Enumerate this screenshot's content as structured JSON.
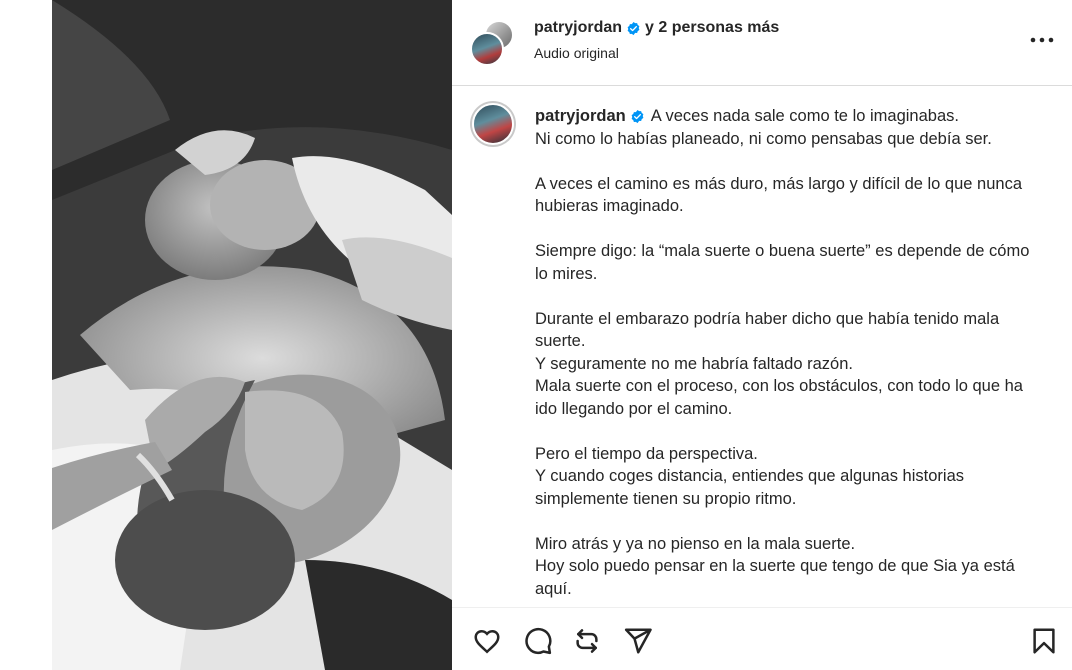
{
  "post": {
    "header": {
      "username": "patryjordan",
      "collab_text": "y 2 personas más",
      "audio": "Audio original",
      "more_icon": "more-horizontal-icon"
    },
    "caption": {
      "username": "patryjordan",
      "lines": [
        "A veces nada sale como te lo imaginabas.",
        "Ni como lo habías planeado, ni como pensabas que debía ser.",
        "",
        "A veces el camino es más duro, más largo y difícil de lo que nunca hubieras imaginado.",
        "",
        "Siempre digo: la “mala suerte o buena suerte” es depende de cómo lo mires.",
        "",
        "Durante el embarazo podría haber dicho que había tenido mala suerte.",
        "Y seguramente no me habría faltado razón.",
        "Mala suerte con el proceso, con los obstáculos, con todo lo que ha ido llegando por el camino.",
        "",
        "Pero el tiempo da perspectiva.",
        "Y cuando coges distancia, entiendes que algunas historias simplemente tienen su propio ritmo.",
        "",
        "Miro atrás y ya no pienso en la mala suerte.",
        "Hoy solo puedo pensar en la suerte que tengo de que Sia ya está aquí."
      ]
    },
    "actions": {
      "like_icon": "heart-icon",
      "comment_icon": "comment-icon",
      "repost_icon": "repost-icon",
      "share_icon": "send-icon",
      "save_icon": "bookmark-icon"
    },
    "colors": {
      "verified": "#0095f6",
      "text": "#262626",
      "divider": "#dbdbdb"
    }
  }
}
